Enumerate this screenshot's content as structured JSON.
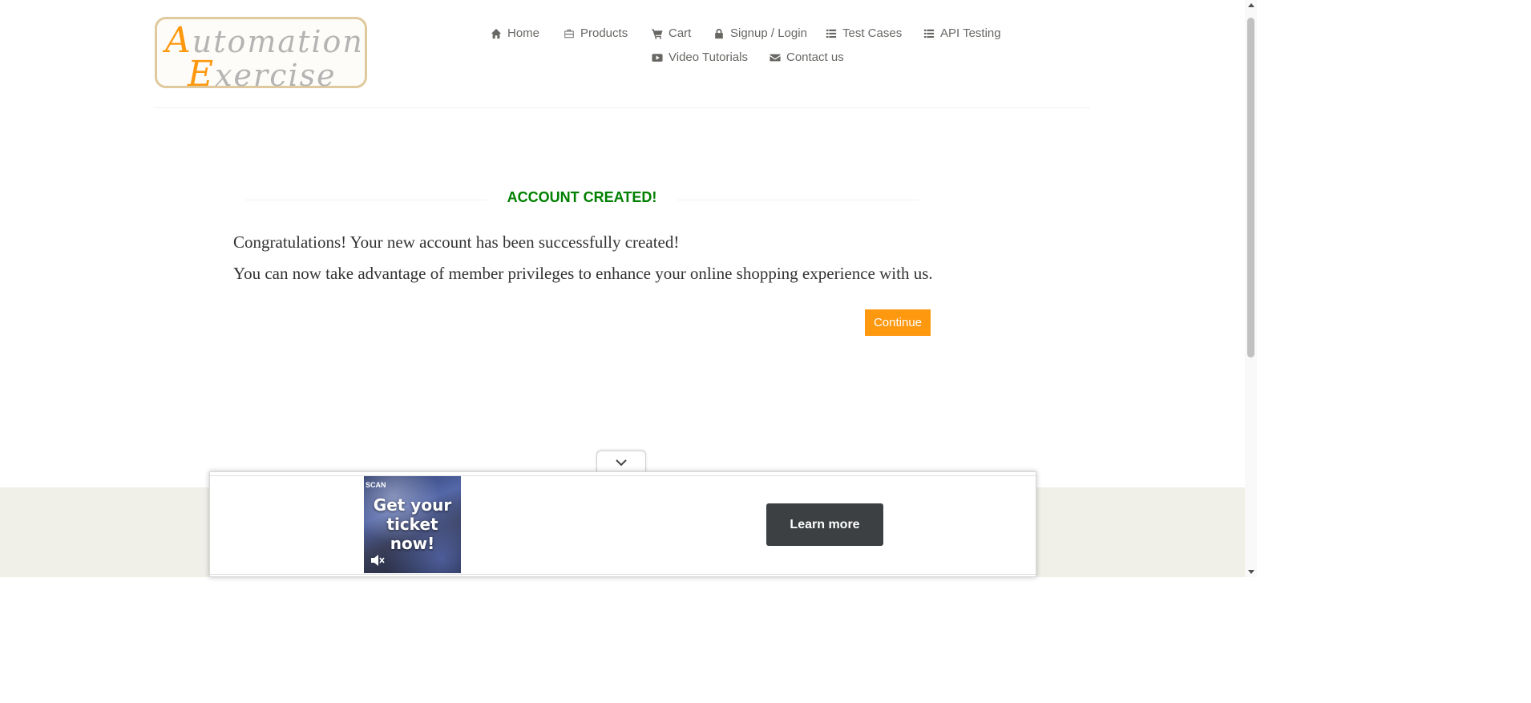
{
  "logo": {
    "line1_cap": "A",
    "line1_rest": "utomation",
    "line2_cap": "E",
    "line2_rest": "xercise"
  },
  "nav": {
    "items": [
      {
        "label": "Home",
        "icon": "home-icon"
      },
      {
        "label": "Products",
        "icon": "briefcase-icon"
      },
      {
        "label": "Cart",
        "icon": "cart-icon"
      },
      {
        "label": "Signup / Login",
        "icon": "lock-icon"
      },
      {
        "label": "Test Cases",
        "icon": "list-icon"
      },
      {
        "label": "API Testing",
        "icon": "list-icon"
      },
      {
        "label": "Video Tutorials",
        "icon": "youtube-icon"
      },
      {
        "label": "Contact us",
        "icon": "envelope-icon"
      }
    ]
  },
  "content": {
    "title": "ACCOUNT CREATED!",
    "message1": "Congratulations! Your new account has been successfully created!",
    "message2": "You can now take advantage of member privileges to enhance your online shopping experience with us.",
    "continue_label": "Continue"
  },
  "ad": {
    "image_text": "Get your ticket now!",
    "image_corner_text": "SCAN",
    "cta_label": "Learn more"
  },
  "colors": {
    "accent": "#FE980F",
    "success": "#008000",
    "footer_bg": "#F0F0E9"
  }
}
